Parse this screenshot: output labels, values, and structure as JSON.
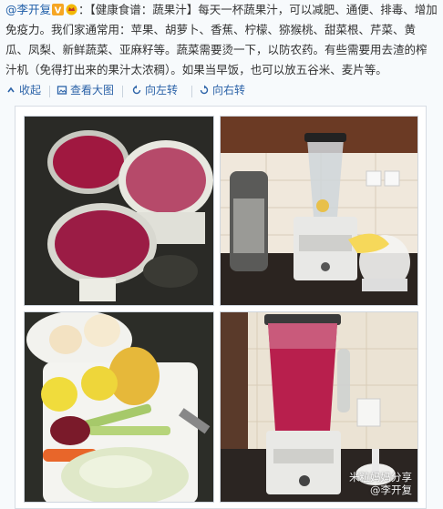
{
  "post": {
    "author": "@李开复",
    "body": "：【健康食谱：蔬果汁】每天一杯蔬果汁，可以减肥、通便、排毒、增加免疫力。我们家通常用：苹果、胡萝卜、香蕉、柠檬、猕猴桃、甜菜根、芹菜、黄瓜、凤梨、新鲜蔬菜、亚麻籽等。蔬菜需要烫一下，以防农药。有些需要用去渣的榨汁机（免得打出来的果汁太浓稠）。如果当早饭，也可以放五谷米、麦片等。"
  },
  "toolbar": {
    "collapse_label": "收起",
    "view_large_label": "查看大图",
    "rotate_left_label": "向左转",
    "rotate_right_label": "向右转"
  },
  "watermark": {
    "line1": "米粒妈妈分享",
    "line2": "@李开复"
  },
  "colors": {
    "link": "#2c63a8",
    "author": "#1f5ea8",
    "juice": "#9b1c45"
  }
}
